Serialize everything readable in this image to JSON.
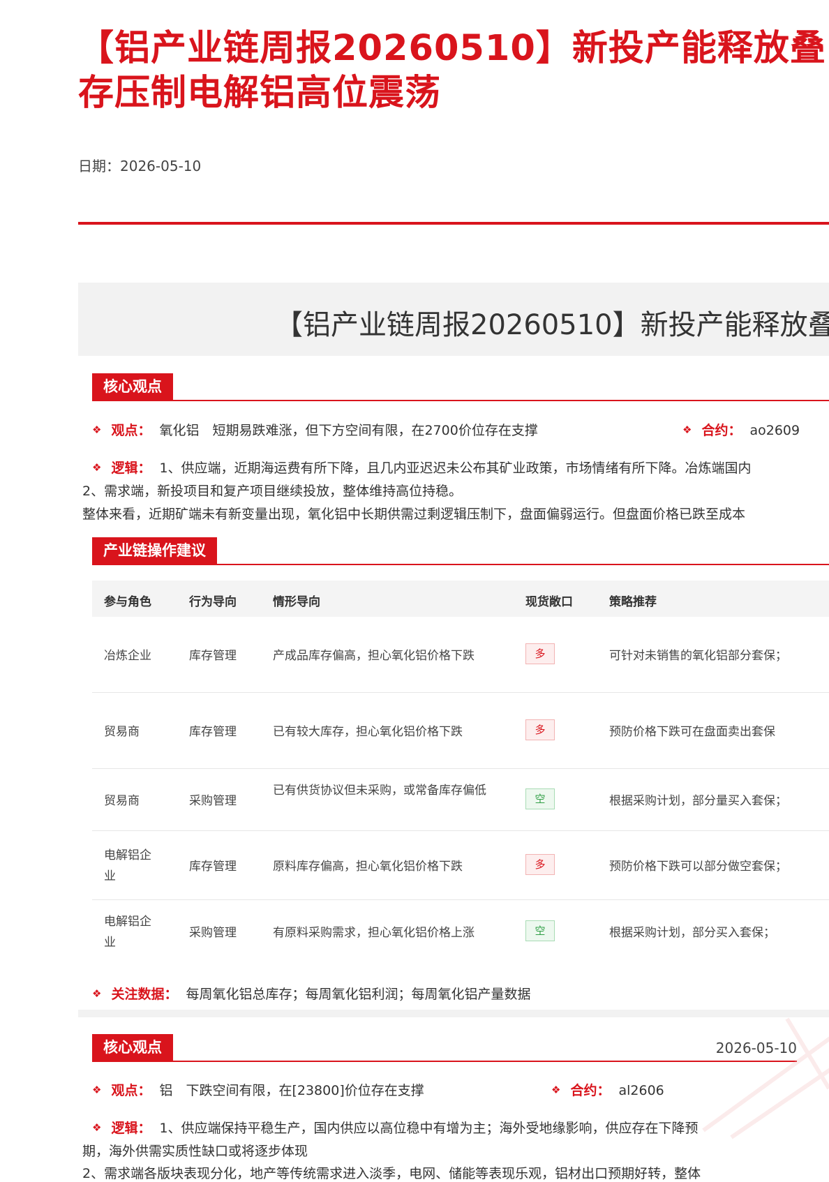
{
  "header": {
    "title_line1": "【铝产业链周报20260510】新投产能释放叠",
    "title_line2": "存压制电解铝高位震荡",
    "date_line": "日期：2026-05-10"
  },
  "report_band_title": "【铝产业链周报20260510】新投产能释放叠",
  "section1": {
    "tag": "核心观点",
    "view_label": "观点：",
    "view_text": "氧化铝　短期易跌难涨，但下方空间有限，在2700价位存在支撑",
    "contract_label": "合约：",
    "contract_value": "ao2609",
    "logic_label": "逻辑：",
    "logic_line1": "1、供应端，近期海运费有所下降，且几内亚迟迟未公布其矿业政策，市场情绪有所下降。冶炼端国内",
    "logic_line2": "2、需求端，新投项目和复产项目继续投放，整体维持高位持稳。",
    "logic_line3": "整体来看，近期矿端未有新变量出现，氧化铝中长期供需过剩逻辑压制下，盘面偏弱运行。但盘面价格已跌至成本"
  },
  "section2": {
    "tag": "产业链操作建议",
    "headers": [
      "参与角色",
      "行为导向",
      "情形导向",
      "现货敞口",
      "策略推荐"
    ],
    "rows": [
      {
        "role": "冶炼企业",
        "action": "库存管理",
        "situation": "产成品库存偏高，担心氧化铝价格下跌",
        "exposure": "多",
        "strategy": "可针对未销售的氧化铝部分套保；"
      },
      {
        "role": "贸易商",
        "action": "库存管理",
        "situation": "已有较大库存，担心氧化铝价格下跌",
        "exposure": "多",
        "strategy": "预防价格下跌可在盘面卖出套保"
      },
      {
        "role": "贸易商",
        "action": "采购管理",
        "situation": "已有供货协议但未采购，或常备库存偏低",
        "exposure": "空",
        "strategy": "根据采购计划，部分量买入套保；"
      },
      {
        "role": "电解铝企业",
        "action": "库存管理",
        "situation": "原料库存偏高，担心氧化铝价格下跌",
        "exposure": "多",
        "strategy": "预防价格下跌可以部分做空套保；"
      },
      {
        "role": "电解铝企业",
        "action": "采购管理",
        "situation": "有原料采购需求，担心氧化铝价格上涨",
        "exposure": "空",
        "strategy": "根据采购计划，部分买入套保；"
      }
    ],
    "watch_label": "关注数据：",
    "watch_text": "每周氧化铝总库存；每周氧化铝利润；每周氧化铝产量数据"
  },
  "section3": {
    "tag": "核心观点",
    "date": "2026-05-10",
    "view_label": "观点：",
    "view_text": "铝　下跌空间有限，在[23800]价位存在支撑",
    "contract_label": "合约：",
    "contract_value": "al2606",
    "logic_label": "逻辑：",
    "logic_line1": "1、供应端保持平稳生产，国内供应以高位稳中有增为主；海外受地缘影响，供应存在下降预",
    "logic_line2": "期，海外供需实质性缺口或将逐步体现",
    "logic_line3": "2、需求端各版块表现分化，地产等传统需求进入淡季，电网、储能等表现乐观，铝材出口预期好转，整体"
  },
  "colors": {
    "accent": "#d9141c",
    "long_badge": "#d9141c",
    "short_badge": "#2f9e44"
  }
}
